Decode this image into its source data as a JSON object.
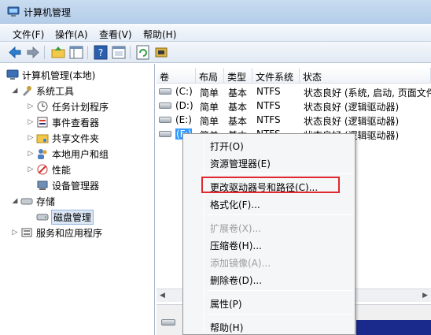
{
  "window": {
    "title": "计算机管理"
  },
  "menu": [
    "文件(F)",
    "操作(A)",
    "查看(V)",
    "帮助(H)"
  ],
  "toolbar": {
    "icons": [
      "back-arrow-icon",
      "forward-arrow-icon",
      "up-folder-icon",
      "show-hide-tree-icon",
      "help-icon",
      "properties-icon",
      "refresh-icon",
      "disk-settings-icon"
    ]
  },
  "tree": {
    "root": "计算机管理(本地)",
    "system_tools": "系统工具",
    "items": [
      "任务计划程序",
      "事件查看器",
      "共享文件夹",
      "本地用户和组",
      "性能",
      "设备管理器"
    ],
    "storage": "存储",
    "disk_management": "磁盘管理",
    "services": "服务和应用程序"
  },
  "list": {
    "columns": [
      "卷",
      "布局",
      "类型",
      "文件系统",
      "状态"
    ],
    "rows": [
      {
        "vol": "(C:)",
        "layout": "简单",
        "type": "基本",
        "fs": "NTFS",
        "status": "状态良好 (系统, 启动, 页面文件"
      },
      {
        "vol": "(D:)",
        "layout": "简单",
        "type": "基本",
        "fs": "NTFS",
        "status": "状态良好 (逻辑驱动器)"
      },
      {
        "vol": "(E:)",
        "layout": "简单",
        "type": "基本",
        "fs": "NTFS",
        "status": "状态良好 (逻辑驱动器)"
      },
      {
        "vol": "(F:)",
        "layout": "简单",
        "type": "基本",
        "fs": "NTFS",
        "status": "状态良好 (逻辑驱动器)"
      }
    ]
  },
  "context_menu": {
    "open": "打开(O)",
    "explore": "资源管理器(E)",
    "change_letter": "更改驱动器号和路径(C)...",
    "format": "格式化(F)...",
    "extend": "扩展卷(X)...",
    "shrink": "压缩卷(H)...",
    "mirror": "添加镜像(A)...",
    "delete": "删除卷(D)...",
    "properties": "属性(P)",
    "help": "帮助(H)"
  },
  "colors": {
    "highlight_border": "#e0282f",
    "selection": "#3399ff"
  }
}
